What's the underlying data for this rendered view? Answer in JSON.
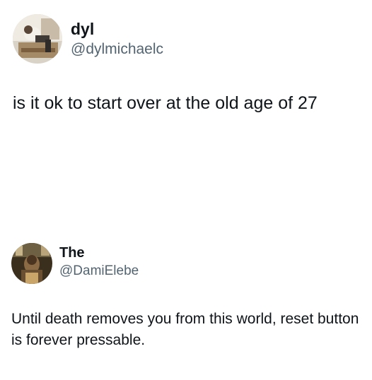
{
  "tweets": [
    {
      "avatar_icon": "user-photo-avatar",
      "display_name": "dyl",
      "handle": "@dylmichaelc",
      "text": "is it ok to start over at the old age of 27"
    },
    {
      "avatar_icon": "user-photo-avatar",
      "display_name": "The",
      "handle": "@DamiElebe",
      "text": "Until death removes you from this world, reset button is forever pressable."
    }
  ]
}
